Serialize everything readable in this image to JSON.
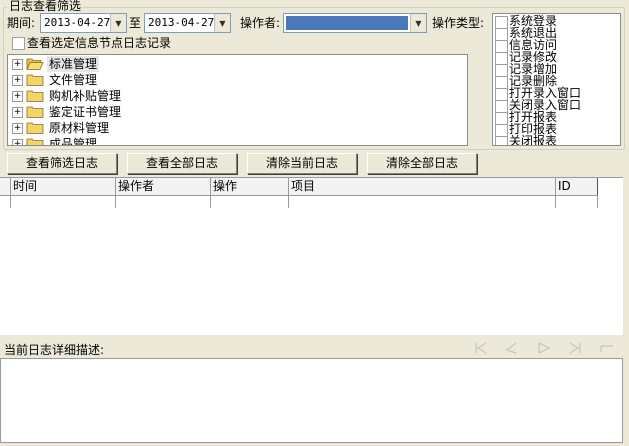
{
  "filter": {
    "title": "日志查看筛选",
    "period_label": "期间:",
    "start_date": "2013-04-27",
    "to_label": "至",
    "end_date": "2013-04-27",
    "operator_label": "操作者:",
    "operator_value": "",
    "op_type_label": "操作类型:",
    "node_check_label": "查看选定信息节点日志记录"
  },
  "tree": {
    "items": [
      {
        "label": "标准管理"
      },
      {
        "label": "文件管理"
      },
      {
        "label": "购机补贴管理"
      },
      {
        "label": "鉴定证书管理"
      },
      {
        "label": "原材料管理"
      },
      {
        "label": "成品管理"
      }
    ]
  },
  "op_types": [
    "系统登录",
    "系统退出",
    "信息访问",
    "记录修改",
    "记录增加",
    "记录删除",
    "打开录入窗口",
    "关闭录入窗口",
    "打开报表",
    "打印报表",
    "关闭报表"
  ],
  "buttons": {
    "view_filtered": "查看筛选日志",
    "view_all": "查看全部日志",
    "clear_current": "清除当前日志",
    "clear_all": "清除全部日志"
  },
  "grid": {
    "columns": [
      "时间",
      "操作者",
      "操作",
      "项目",
      "ID"
    ]
  },
  "detail": {
    "label": "当前日志详细描述:"
  },
  "colors": {
    "operator_fill": "#4a78b8",
    "background": "#ece9d8"
  }
}
